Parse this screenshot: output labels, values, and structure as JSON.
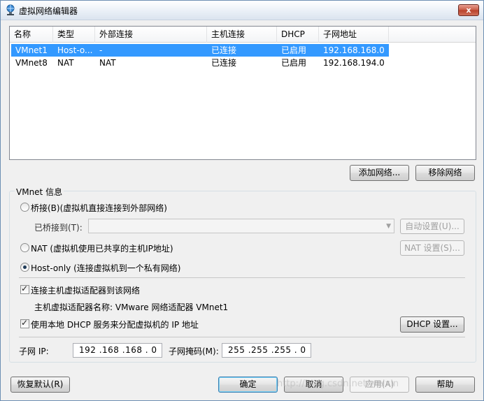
{
  "window": {
    "title": "虚拟网络编辑器",
    "close_label": "x"
  },
  "table": {
    "columns": [
      "名称",
      "类型",
      "外部连接",
      "主机连接",
      "DHCP",
      "子网地址"
    ],
    "rows": [
      [
        "VMnet1",
        "Host-o...",
        "-",
        "已连接",
        "已启用",
        "192.168.168.0"
      ],
      [
        "VMnet8",
        "NAT",
        "NAT",
        "已连接",
        "已启用",
        "192.168.194.0"
      ]
    ],
    "selected_row": 0
  },
  "list_buttons": {
    "add": "添加网络...",
    "remove": "移除网络"
  },
  "vmnet_info": {
    "legend": "VMnet 信息",
    "bridged_label": "桥接(B)(虚拟机直接连接到外部网络)",
    "bridged_to_label": "已桥接到(T):",
    "bridged_to_value": "",
    "auto_settings": "自动设置(U)...",
    "nat_label": "NAT (虚拟机使用已共享的主机IP地址)",
    "nat_settings": "NAT 设置(S)...",
    "hostonly_label": "Host-only (连接虚拟机到一个私有网络)",
    "mode": "host-only",
    "connect_adapter_label": "连接主机虚拟适配器到该网络",
    "connect_adapter_checked": true,
    "adapter_name_text": "主机虚拟适配器名称: VMware 网络适配器 VMnet1",
    "use_dhcp_label": "使用本地 DHCP 服务来分配虚拟机的 IP 地址",
    "use_dhcp_checked": true,
    "dhcp_settings": "DHCP 设置...",
    "subnet_ip_label": "子网 IP:",
    "subnet_ip_value": "192 .168 .168 .  0",
    "subnet_mask_label": "子网掩码(M):",
    "subnet_mask_value": "255 .255 .255 .  0"
  },
  "footer": {
    "restore_defaults": "恢复默认(R)",
    "ok": "确定",
    "cancel": "取消",
    "apply": "应用(A)",
    "help": "帮助"
  },
  "watermark_text": "http://blog.csdn.net/weixin",
  "colors": {
    "selection": "#3399ff",
    "window_bg": "#f0f0f0"
  }
}
